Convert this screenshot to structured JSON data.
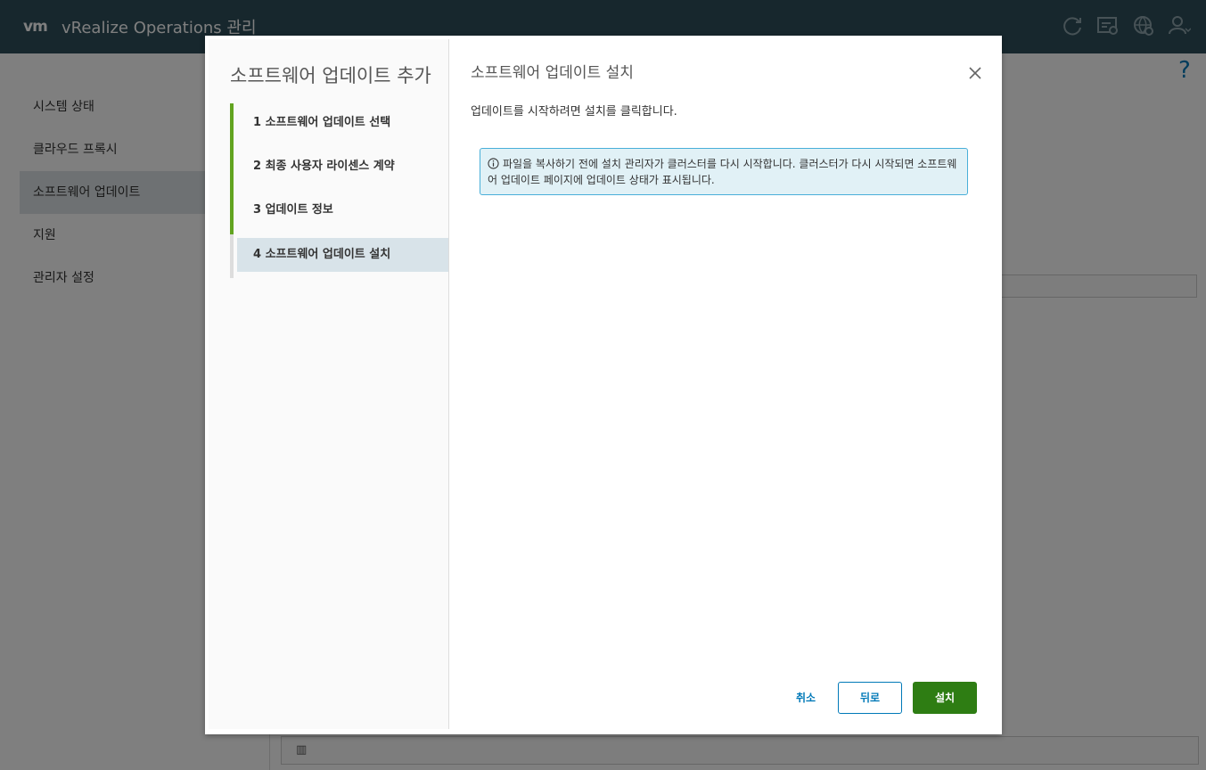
{
  "app": {
    "logo": "vm",
    "title": "vRealize Operations 관리"
  },
  "sidebar": {
    "items": [
      {
        "label": "시스템 상태"
      },
      {
        "label": "클라우드 프록시"
      },
      {
        "label": "소프트웨어 업데이트"
      },
      {
        "label": "지원"
      },
      {
        "label": "관리자 설정"
      }
    ]
  },
  "header_icons": [
    "refresh-icon",
    "task-icon",
    "globe-settings-icon",
    "user-icon"
  ],
  "help": "?",
  "wizard": {
    "title": "소프트웨어 업데이트 추가",
    "steps": [
      {
        "label": "1  소프트웨어 업데이트 선택"
      },
      {
        "label": "2 최종 사용자 라이센스 계약"
      },
      {
        "label": "3 업데이트 정보"
      },
      {
        "label": "4 소프트웨어 업데이트 설치"
      }
    ],
    "page_title": "소프트웨어 업데이트 설치",
    "description": "업데이트를 시작하려면 설치를 클릭합니다.",
    "info_message": "파일을 복사하기 전에 설치 관리자가 클러스터를 다시 시작합니다. 클러스터가 다시 시작되면 소프트웨어 업데이트 페이지에 업데이트 상태가 표시됩니다.",
    "buttons": {
      "cancel": "취소",
      "back": "뒤로",
      "install": "설치"
    }
  },
  "colors": {
    "header_bg": "#2f4f5a",
    "step_complete": "#62a420",
    "primary_button": "#2e7d13",
    "link_blue": "#0079b8",
    "info_bg": "#e1f1f6",
    "info_border": "#49afd9"
  }
}
